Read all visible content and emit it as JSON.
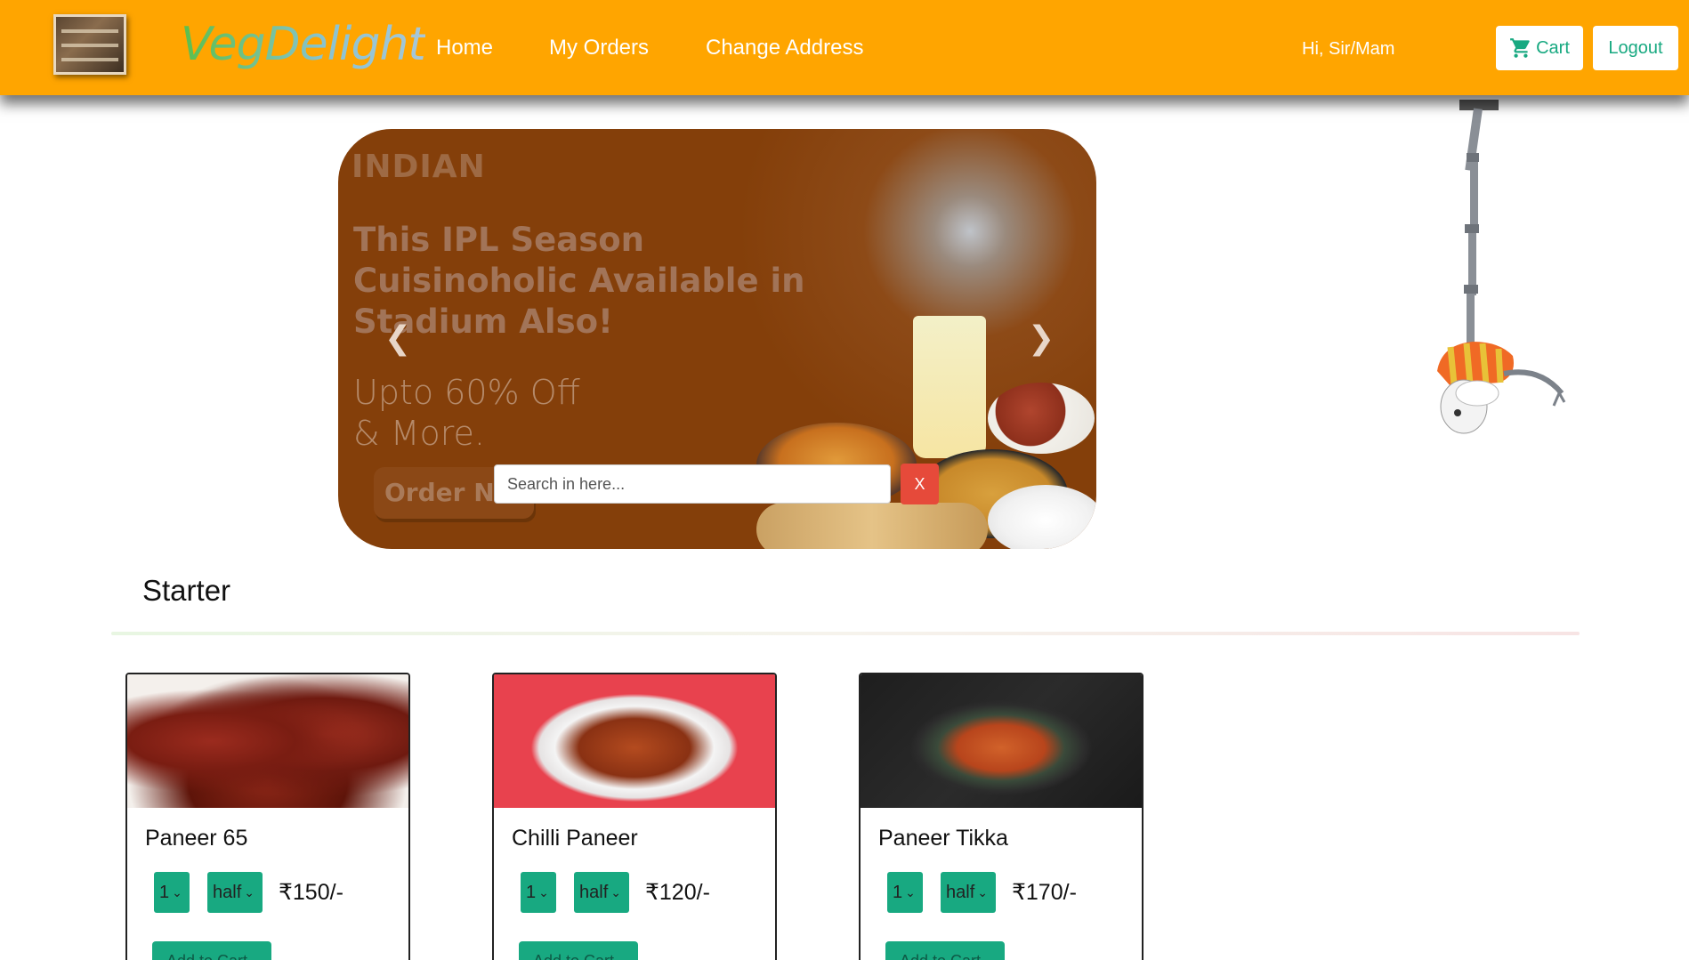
{
  "nav": {
    "brand": "VegDelight",
    "links": [
      "Home",
      "My Orders",
      "Change Address"
    ],
    "greeting": "Hi, Sir/Mam",
    "cart_label": "Cart",
    "logout_label": "Logout"
  },
  "banner": {
    "tag": "INDIAN",
    "headline": "This IPL Season Cuisinoholic Available in Stadium Also!",
    "offer_line1": "Upto 60% Off",
    "offer_line2": "& More.",
    "order_button": "Order Now"
  },
  "search": {
    "placeholder": "Search in here...",
    "clear_label": "X"
  },
  "section": {
    "title": "Starter"
  },
  "items": [
    {
      "name": "Paneer 65",
      "qty": "1",
      "size": "half",
      "price": "₹150/-",
      "add_label": "Add to Cart"
    },
    {
      "name": "Chilli Paneer",
      "qty": "1",
      "size": "half",
      "price": "₹120/-",
      "add_label": "Add to Cart"
    },
    {
      "name": "Paneer Tikka",
      "qty": "1",
      "size": "half",
      "price": "₹170/-",
      "add_label": "Add to Cart"
    }
  ],
  "colors": {
    "navbar": "#ffa500",
    "accent": "#18a981",
    "banner": "#843f0a",
    "danger": "#e64a3a"
  }
}
